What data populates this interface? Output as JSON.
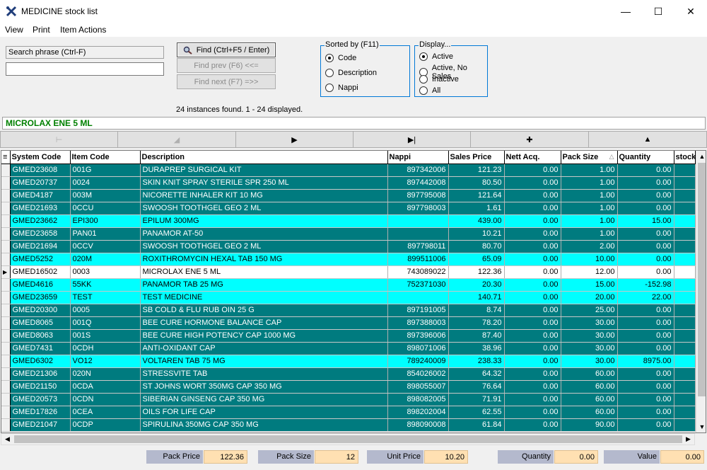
{
  "window": {
    "title": "MEDICINE stock list",
    "minimize": "—",
    "maximize": "☐",
    "close": "✕"
  },
  "menu": [
    "View",
    "Print",
    "Item Actions"
  ],
  "search": {
    "label": "Search phrase (Ctrl-F)",
    "value": "",
    "find_label": "Find (Ctrl+F5 / Enter)",
    "prev_label": "Find prev (F6) <<=",
    "next_label": "Find next (F7) =>>",
    "found_text": "24 instances found.  1 - 24 displayed."
  },
  "sorted_by": {
    "title": "Sorted by (F11)",
    "options": [
      "Code",
      "Description",
      "Nappi"
    ],
    "selected": 0
  },
  "display": {
    "title": "Display...",
    "options": [
      "Active",
      "Active, No Sales",
      "Inactive",
      "All"
    ],
    "selected": 0
  },
  "selected_item": "MICROLAX ENE 5 ML",
  "nav_buttons": [
    "⊢",
    "◢",
    "▶",
    "▶|",
    "✚",
    "▲"
  ],
  "grid": {
    "columns": [
      "System Code",
      "Item Code",
      "Description",
      "Nappi",
      "Sales Price",
      "Nett Acq.",
      "Pack Size",
      "Quantity",
      "stock"
    ],
    "sort_indicator": "△",
    "rows": [
      {
        "style": "teal",
        "cells": [
          "GMED23608",
          "001G",
          "DURAPREP SURGICAL KIT",
          "897342006",
          "121.23",
          "0.00",
          "1.00",
          "0.00",
          ""
        ]
      },
      {
        "style": "teal",
        "cells": [
          "GMED20737",
          "0024",
          "SKIN KNIT SPRAY STERILE SPR 250 ML",
          "897442008",
          "80.50",
          "0.00",
          "1.00",
          "0.00",
          ""
        ]
      },
      {
        "style": "teal",
        "cells": [
          "GMED4187",
          "003M",
          "NICORETTE INHALER KIT 10 MG",
          "897795008",
          "121.64",
          "0.00",
          "1.00",
          "0.00",
          ""
        ]
      },
      {
        "style": "teal",
        "cells": [
          "GMED21693",
          "0CCU",
          "SWOOSH TOOTHGEL GEO 2 ML",
          "897798003",
          "1.61",
          "0.00",
          "1.00",
          "0.00",
          ""
        ]
      },
      {
        "style": "cyan",
        "cells": [
          "GMED23662",
          "EPI300",
          "EPILUM 300MG",
          "",
          "439.00",
          "0.00",
          "1.00",
          "15.00",
          ""
        ]
      },
      {
        "style": "teal",
        "cells": [
          "GMED23658",
          "PAN01",
          "PANAMOR AT-50",
          "",
          "10.21",
          "0.00",
          "1.00",
          "0.00",
          ""
        ]
      },
      {
        "style": "teal",
        "cells": [
          "GMED21694",
          "0CCV",
          "SWOOSH TOOTHGEL GEO 2 ML",
          "897798011",
          "80.70",
          "0.00",
          "2.00",
          "0.00",
          ""
        ]
      },
      {
        "style": "cyan",
        "cells": [
          "GMED5252",
          "020M",
          "ROXITHROMYCIN HEXAL TAB 150 MG",
          "899511006",
          "65.09",
          "0.00",
          "10.00",
          "0.00",
          ""
        ]
      },
      {
        "style": "sel",
        "cells": [
          "GMED16502",
          "0003",
          "MICROLAX ENE 5 ML",
          "743089022",
          "122.36",
          "0.00",
          "12.00",
          "0.00",
          ""
        ]
      },
      {
        "style": "cyan",
        "cells": [
          "GMED4616",
          "55KK",
          "PANAMOR TAB 25 MG",
          "752371030",
          "20.30",
          "0.00",
          "15.00",
          "-152.98",
          ""
        ]
      },
      {
        "style": "cyan",
        "cells": [
          "GMED23659",
          "TEST",
          "TEST MEDICINE",
          "",
          "140.71",
          "0.00",
          "20.00",
          "22.00",
          ""
        ]
      },
      {
        "style": "teal",
        "cells": [
          "GMED20300",
          "0005",
          "SB COLD & FLU RUB OIN 25 G",
          "897191005",
          "8.74",
          "0.00",
          "25.00",
          "0.00",
          ""
        ]
      },
      {
        "style": "teal",
        "cells": [
          "GMED8065",
          "001Q",
          "BEE CURE HORMONE BALANCE CAP",
          "897388003",
          "78.20",
          "0.00",
          "30.00",
          "0.00",
          ""
        ]
      },
      {
        "style": "teal",
        "cells": [
          "GMED8063",
          "001S",
          "BEE CURE HIGH POTENCY CAP 1000 MG",
          "897396006",
          "87.40",
          "0.00",
          "30.00",
          "0.00",
          ""
        ]
      },
      {
        "style": "teal",
        "cells": [
          "GMED7431",
          "0CDH",
          "ANTI-OXIDANT CAP",
          "898071006",
          "38.96",
          "0.00",
          "30.00",
          "0.00",
          ""
        ]
      },
      {
        "style": "cyan",
        "cells": [
          "GMED6302",
          "VO12",
          "VOLTAREN TAB 75 MG",
          "789240009",
          "238.33",
          "0.00",
          "30.00",
          "8975.00",
          ""
        ]
      },
      {
        "style": "teal",
        "cells": [
          "GMED21306",
          "020N",
          "STRESSVITE TAB",
          "854026002",
          "64.32",
          "0.00",
          "60.00",
          "0.00",
          ""
        ]
      },
      {
        "style": "teal",
        "cells": [
          "GMED21150",
          "0CDA",
          "ST JOHNS WORT 350MG CAP 350 MG",
          "898055007",
          "76.64",
          "0.00",
          "60.00",
          "0.00",
          ""
        ]
      },
      {
        "style": "teal",
        "cells": [
          "GMED20573",
          "0CDN",
          "SIBERIAN GINSENG CAP 350 MG",
          "898082005",
          "71.91",
          "0.00",
          "60.00",
          "0.00",
          ""
        ]
      },
      {
        "style": "teal",
        "cells": [
          "GMED17826",
          "0CEA",
          "OILS FOR LIFE CAP",
          "898202004",
          "62.55",
          "0.00",
          "60.00",
          "0.00",
          ""
        ]
      },
      {
        "style": "teal",
        "cells": [
          "GMED21047",
          "0CDP",
          "SPIRULINA 350MG CAP 350 MG",
          "898090008",
          "61.84",
          "0.00",
          "90.00",
          "0.00",
          ""
        ]
      }
    ]
  },
  "footer": [
    {
      "label": "Pack Price",
      "value": "122.36"
    },
    {
      "label": "Pack Size",
      "value": "12"
    },
    {
      "label": "Unit Price",
      "value": "10.20"
    },
    {
      "label": "Quantity",
      "value": "0.00"
    },
    {
      "label": "Value",
      "value": "0.00"
    }
  ],
  "colors": {
    "teal_row": "#007b7f",
    "cyan_row": "#00ffff",
    "selected_item_text": "#008000",
    "groupbox_border": "#0078d7",
    "footer_label_bg": "#b4b9cd",
    "footer_value_bg": "#ffe0b2"
  },
  "icons": {
    "app": "wrench-x-icon",
    "find": "magnifier-icon"
  }
}
